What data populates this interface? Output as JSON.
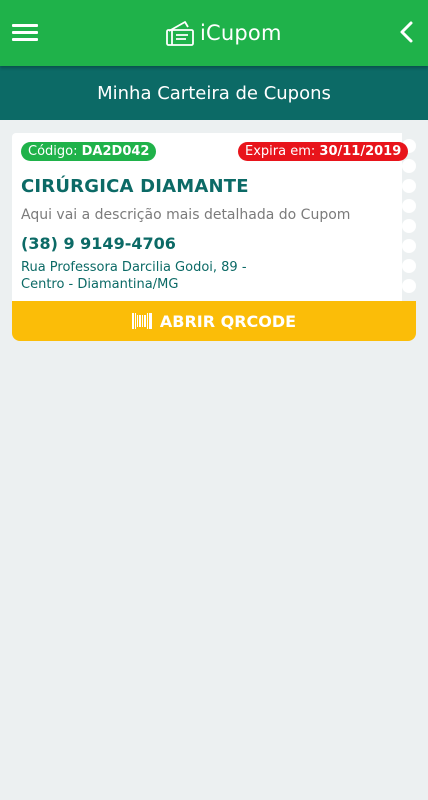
{
  "header": {
    "app_name": "iCupom",
    "menu_icon": "hamburger-menu-icon",
    "back_icon": "chevron-left-icon",
    "logo_icon": "ticket-logo-icon"
  },
  "page": {
    "title": "Minha Carteira de Cupons"
  },
  "coupon": {
    "code_label": "Código:",
    "code_value": "DA2D042",
    "expiry_label": "Expira em:",
    "expiry_value": "30/11/2019",
    "store_name": "CIRÚRGICA DIAMANTE",
    "description": "Aqui vai a descrição mais detalhada do Cupom",
    "phone": "(38) 9 9149-4706",
    "address_line1": "Rua Professora Darcilia Godoi, 89 -",
    "address_line2": "Centro - Diamantina/MG",
    "button_label": "ABRIR QRCODE",
    "button_icon": "barcode-icon"
  },
  "colors": {
    "primary_green": "#1fb24a",
    "dark_teal": "#0c6a66",
    "expiry_red": "#e8141b",
    "button_yellow": "#fbbd08",
    "background": "#ecf0f1"
  }
}
